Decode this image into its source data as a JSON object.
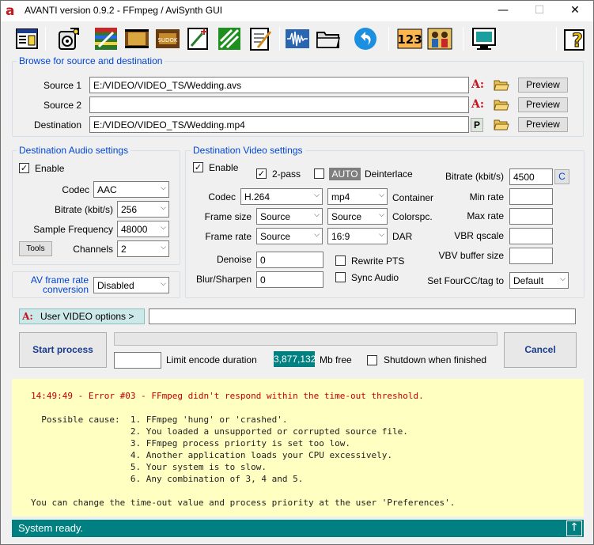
{
  "window": {
    "title": "AVANTI  version  0.9.2   -   FFmpeg / AviSynth GUI",
    "minimize": "—",
    "maximize": "☐",
    "close": "✕"
  },
  "toolbar": {
    "buttons": [
      "window-icon",
      "sound-icon",
      "editor-icon",
      "film-icon",
      "sudoku-icon",
      "wand-icon",
      "ffmpeg-icon",
      "notepad-icon",
      "waveform-icon",
      "folder-icon",
      "undo-icon",
      "counter-icon",
      "crew-icon",
      "monitor-icon",
      "help-icon"
    ]
  },
  "browse": {
    "legend": "Browse for source and destination",
    "source1_label": "Source 1",
    "source1_value": "E:/VIDEO/VIDEO_TS/Wedding.avs",
    "source2_label": "Source 2",
    "source2_value": "",
    "destination_label": "Destination",
    "destination_value": "E:/VIDEO/VIDEO_TS/Wedding.mp4",
    "preview": "Preview",
    "avisynth_glyph": "A:",
    "p_glyph": "P"
  },
  "audio": {
    "legend": "Destination Audio settings",
    "enable_label": "Enable",
    "enable_checked": "✓",
    "codec_label": "Codec",
    "codec_value": "AAC",
    "bitrate_label": "Bitrate (kbit/s)",
    "bitrate_value": "256",
    "freq_label": "Sample Frequency",
    "freq_value": "48000",
    "tools": "Tools",
    "channels_label": "Channels",
    "channels_value": "2"
  },
  "avframe": {
    "label_line1": "AV frame rate",
    "label_line2": "conversion",
    "value": "Disabled"
  },
  "video": {
    "legend": "Destination Video settings",
    "enable_label": "Enable",
    "enable_checked": "✓",
    "twopass_label": "2-pass",
    "twopass_checked": "✓",
    "auto_label": "AUTO",
    "deinterlace_label": "Deinterlace",
    "bitrate_label": "Bitrate (kbit/s)",
    "bitrate_value": "4500",
    "c_button": "C",
    "codec_label": "Codec",
    "codec_value": "H.264",
    "container_value": "mp4",
    "container_label": "Container",
    "minrate_label": "Min rate",
    "framesize_label": "Frame size",
    "framesize_value": "Source",
    "colorspc_value": "Source",
    "colorspc_label": "Colorspc.",
    "maxrate_label": "Max rate",
    "framerate_label": "Frame rate",
    "framerate_value": "Source",
    "dar_value": "16:9",
    "dar_label": "DAR",
    "vbr_label": "VBR qscale",
    "vbv_label": "VBV buffer size",
    "denoise_label": "Denoise",
    "denoise_value": "0",
    "rewrite_label": "Rewrite PTS",
    "blur_label": "Blur/Sharpen",
    "blur_value": "0",
    "sync_label": "Sync Audio",
    "fourcc_label": "Set FourCC/tag to",
    "fourcc_value": "Default"
  },
  "user_options": {
    "button": "User VIDEO options >",
    "value": ""
  },
  "process": {
    "start": "Start process",
    "cancel": "Cancel",
    "limit_value": "",
    "limit_label": "Limit encode duration",
    "free_value": "3,877,132",
    "free_label": "Mb free",
    "shutdown_label": "Shutdown when finished"
  },
  "log": {
    "error_line": "14:49:49 - Error #03 - FFmpeg didn't respond within the time-out threshold.",
    "lines": [
      "  Possible cause:  1. FFmpeg 'hung' or 'crashed'.",
      "                   2. You loaded a unsupported or corrupted source file.",
      "                   3. FFmpeg process priority is set too low.",
      "                   4. Another application loads your CPU excessively.",
      "                   5. Your system is to slow.",
      "                   6. Any combination of 3, 4 and 5."
    ],
    "footer_line": "You can change the time-out value and process priority at the user 'Preferences'."
  },
  "status": {
    "text": "System ready.",
    "up_glyph": "↑"
  },
  "colors": {
    "legend": "#0046d5",
    "status_bg": "#008080",
    "log_bg": "#ffffc1",
    "error": "#c00000",
    "free_badge": "#008080"
  }
}
